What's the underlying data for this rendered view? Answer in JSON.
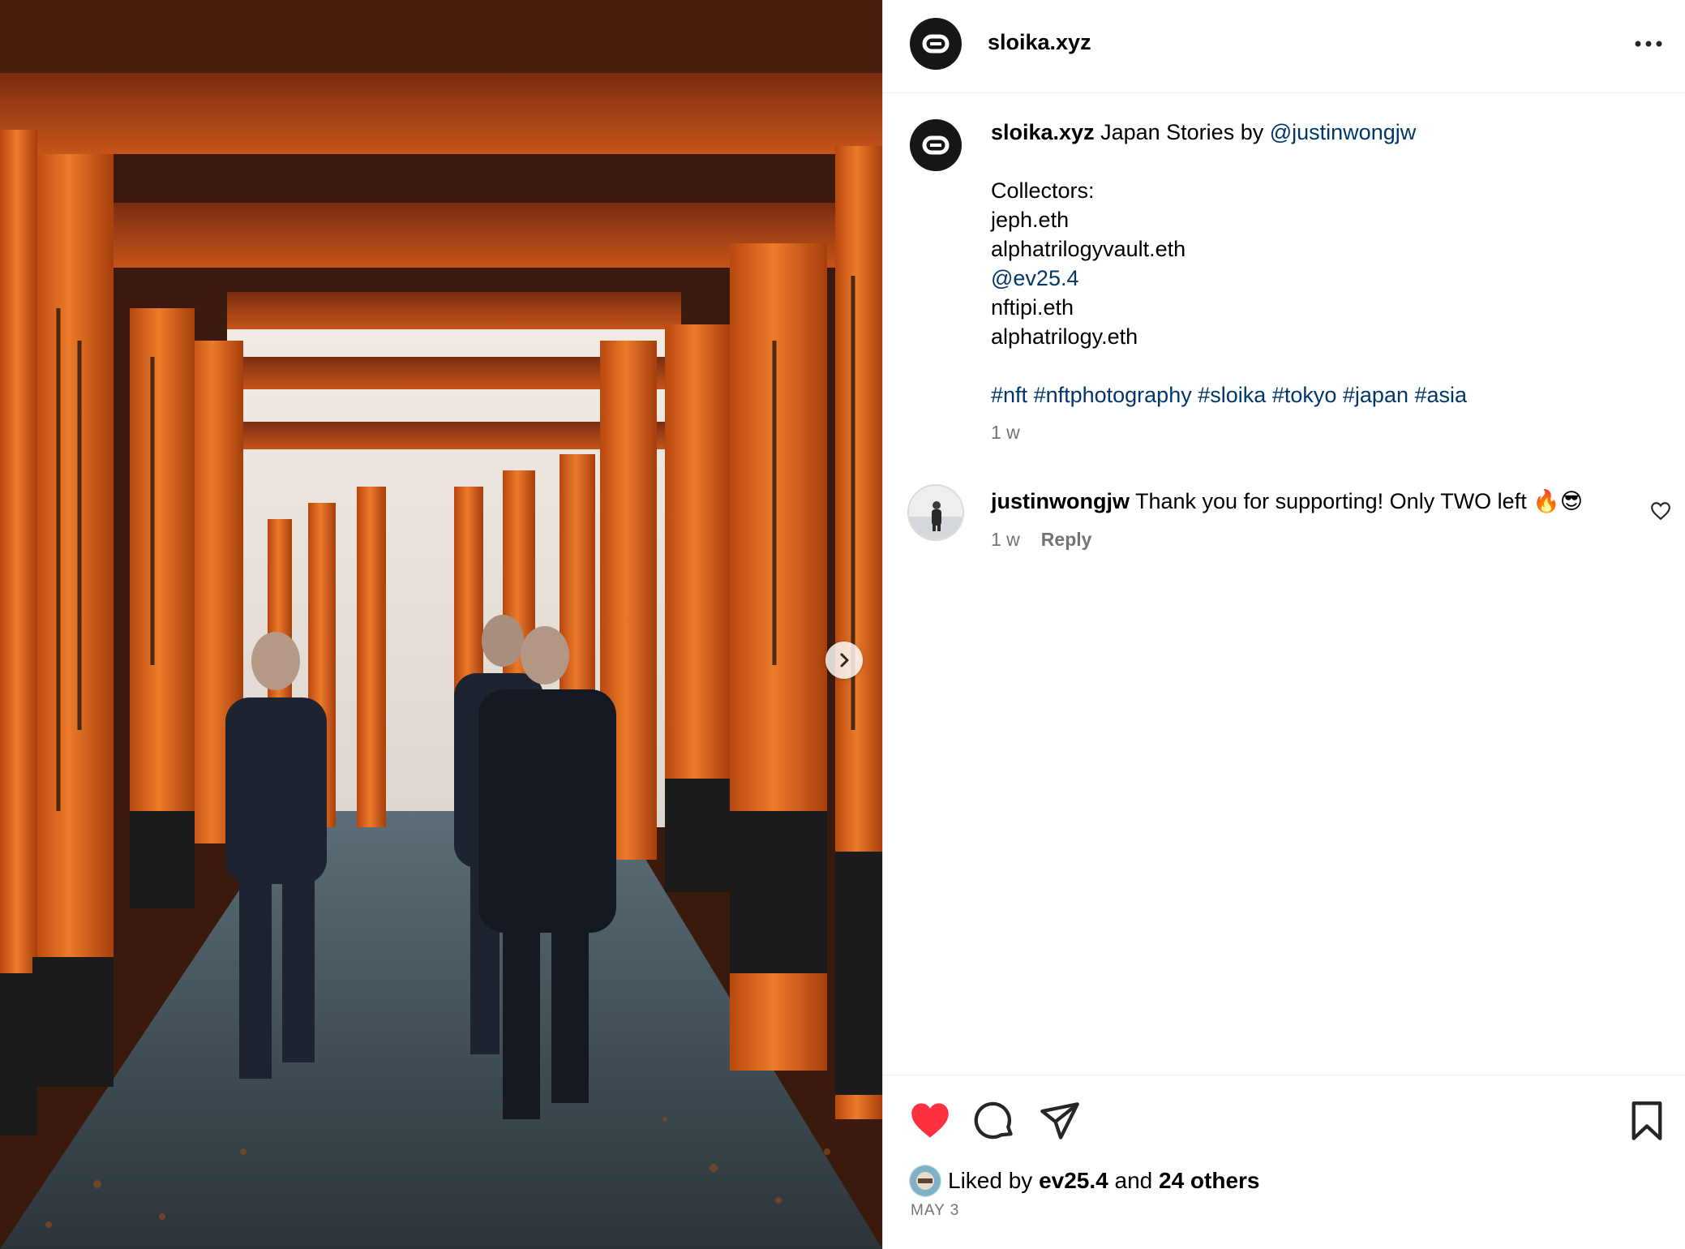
{
  "header": {
    "username": "sloika.xyz",
    "more_icon": "more-horizontal-icon"
  },
  "caption": {
    "username": "sloika.xyz",
    "text": "Japan Stories by",
    "mention": "@justinwongjw",
    "collectors_label": "Collectors:",
    "collectors": [
      {
        "name": "jeph.eth",
        "is_link": false
      },
      {
        "name": "alphatrilogyvault.eth",
        "is_link": false
      },
      {
        "name": "@ev25.4",
        "is_link": true
      },
      {
        "name": "nftipi.eth",
        "is_link": false
      },
      {
        "name": "alphatrilogy.eth",
        "is_link": false
      }
    ],
    "hashtags": [
      "#nft",
      "#nftphotography",
      "#sloika",
      "#tokyo",
      "#japan",
      "#asia"
    ],
    "time": "1 w"
  },
  "comment": {
    "username": "justinwongjw",
    "text": "Thank you for supporting! Only TWO left 🔥😎",
    "time": "1 w",
    "reply_label": "Reply"
  },
  "actions": {
    "liked": true,
    "like_color": "#ff3040",
    "icons": [
      "heart-filled-icon",
      "comment-icon",
      "share-icon",
      "bookmark-icon"
    ]
  },
  "likes": {
    "prefix": "Liked by",
    "user": "ev25.4",
    "conjunction": "and",
    "others": "24 others"
  },
  "date": "MAY 3",
  "colors": {
    "link": "#00376b",
    "secondary_text": "#737373",
    "torii_orange": "#e06a1e"
  }
}
